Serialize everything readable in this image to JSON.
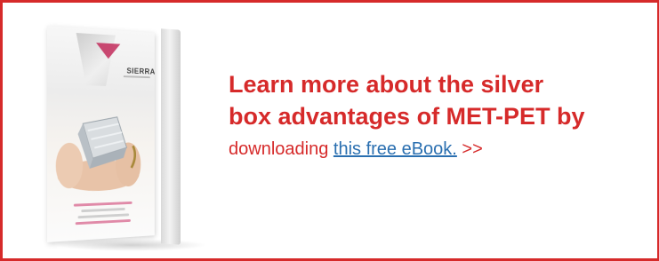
{
  "banner": {
    "headline_line1": "Learn more about the silver",
    "headline_line2": "box advantages of MET-PET by",
    "sub_prefix": "downloading",
    "link_text": "this free eBook.",
    "sub_suffix": ">>"
  },
  "book": {
    "logo_text": "SIERRA",
    "icon": "ebook-cover-icon"
  },
  "colors": {
    "accent": "#d62a2a",
    "link": "#2a6fb0"
  }
}
